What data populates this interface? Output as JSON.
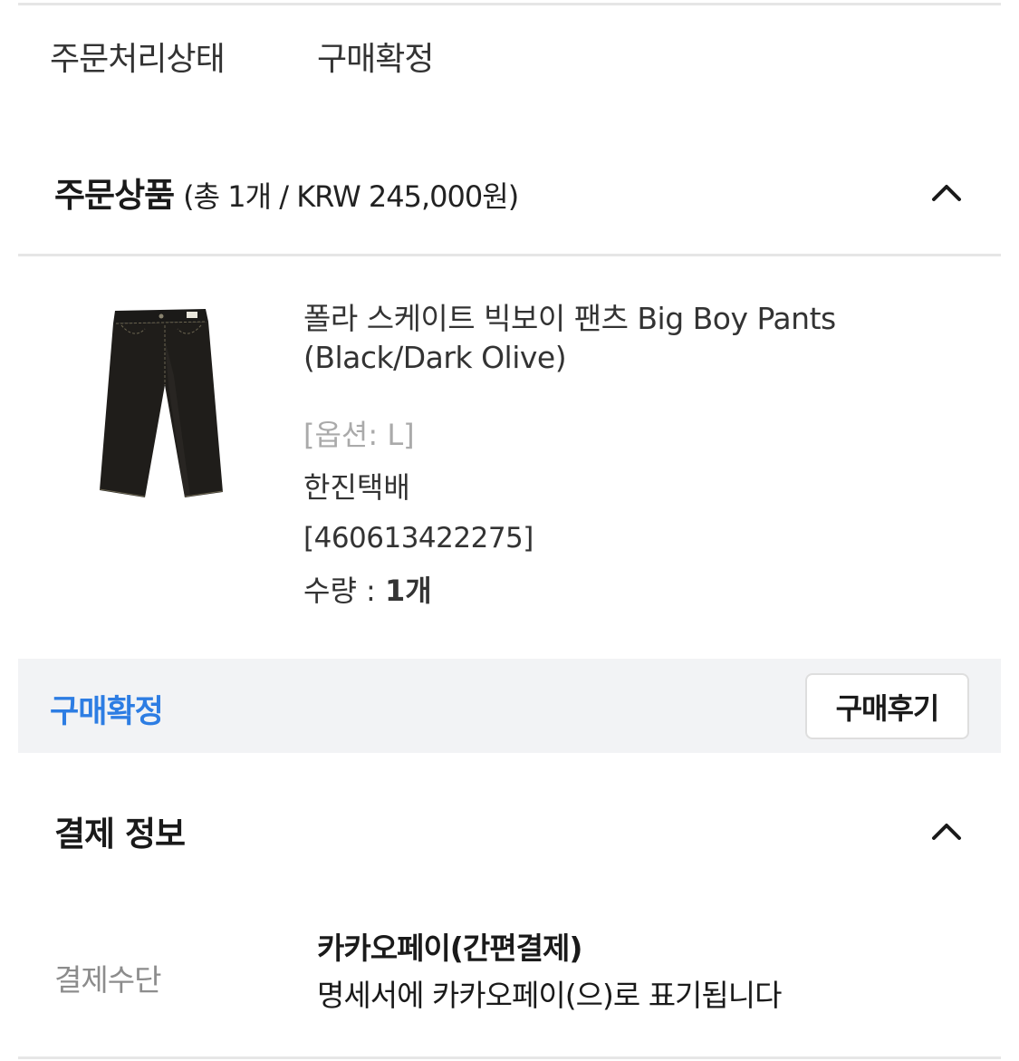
{
  "order_status": {
    "label": "주문처리상태",
    "value": "구매확정"
  },
  "order_items_section": {
    "title": "주문상품",
    "summary": "(총 1개 / KRW 245,000원)",
    "toggle_icon": "chevron-up-icon"
  },
  "product": {
    "name": "폴라 스케이트 빅보이 팬츠 Big Boy Pants (Black/Dark Olive)",
    "option": "[옵션: L]",
    "courier": "한진택배",
    "tracking_number": "[460613422275]",
    "quantity_label": "수량 : ",
    "quantity_value": "1개",
    "image_icon": "black-pants-image"
  },
  "purchase_bar": {
    "status": "구매확정",
    "review_button_label": "구매후기",
    "status_color": "#2d7de3"
  },
  "payment_section": {
    "title": "결제 정보",
    "toggle_icon": "chevron-up-icon",
    "method_label": "결제수단",
    "method_value": "카카오페이(간편결제)",
    "method_note": "명세서에 카카오페이(으)로 표기됩니다"
  }
}
